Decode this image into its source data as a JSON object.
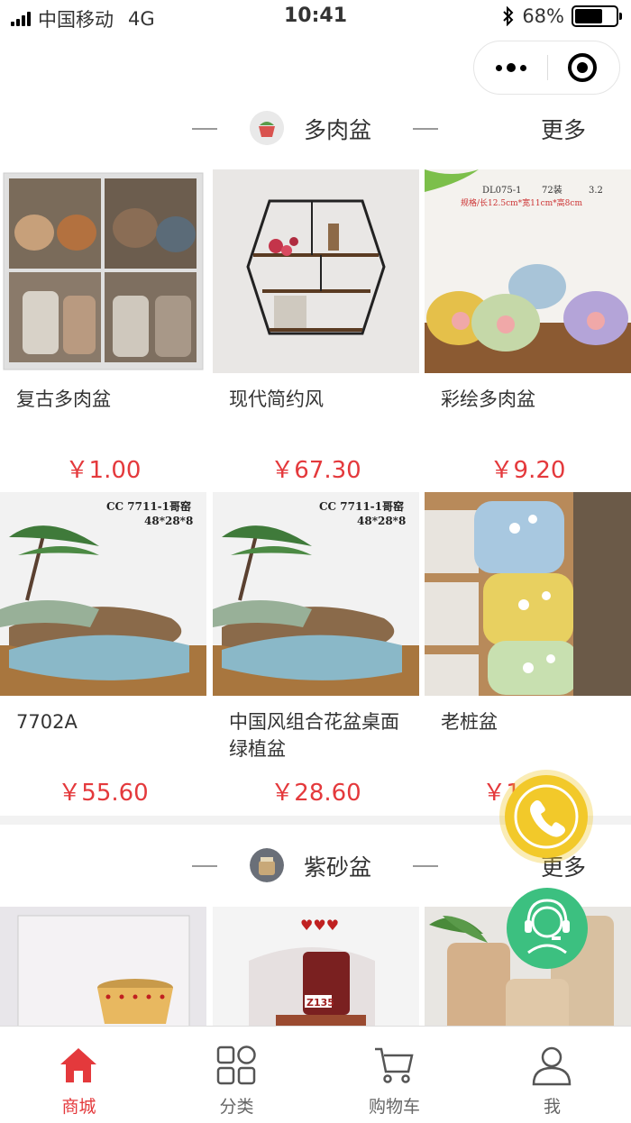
{
  "status_bar": {
    "carrier": "中国移动",
    "network": "4G",
    "time": "10:41",
    "battery": "68%",
    "battery_level": 0.68
  },
  "sections": [
    {
      "title": "多肉盆",
      "more": "更多",
      "products": [
        {
          "name": "复古多肉盆",
          "price": "￥1.00"
        },
        {
          "name": "现代简约风",
          "price": "￥67.30"
        },
        {
          "name": "彩绘多肉盆",
          "price": "￥9.20",
          "image_text": {
            "code": "DL075-1",
            "pack": "72装",
            "unit_price": "3.2",
            "spec": "规格/长12.5cm*宽11cm*高8cm"
          }
        },
        {
          "name": "7702A",
          "price": "￥55.60",
          "image_text": {
            "code": "CC 7711-1哥窑",
            "size": "48*28*8"
          }
        },
        {
          "name": "中国风组合花盆桌面绿植盆",
          "price": "￥28.60",
          "image_text": {
            "code": "CC 7711-1哥窑",
            "size": "48*28*8"
          }
        },
        {
          "name": "老桩盆",
          "price": "￥19.90"
        }
      ]
    },
    {
      "title": "紫砂盆",
      "more": "更多",
      "products": [
        {
          "name": "",
          "price": ""
        },
        {
          "name": "",
          "price": "",
          "image_text": {
            "code": "Z135"
          }
        },
        {
          "name": "",
          "price": ""
        }
      ]
    }
  ],
  "tabbar": [
    {
      "label": "商城",
      "icon": "home-icon",
      "active": true
    },
    {
      "label": "分类",
      "icon": "category-grid-icon",
      "active": false
    },
    {
      "label": "购物车",
      "icon": "cart-icon",
      "active": false
    },
    {
      "label": "我",
      "icon": "user-icon",
      "active": false
    }
  ],
  "colors": {
    "accent": "#e4393c",
    "phone_button": "#f2c92a",
    "service_button": "#3cc080"
  }
}
